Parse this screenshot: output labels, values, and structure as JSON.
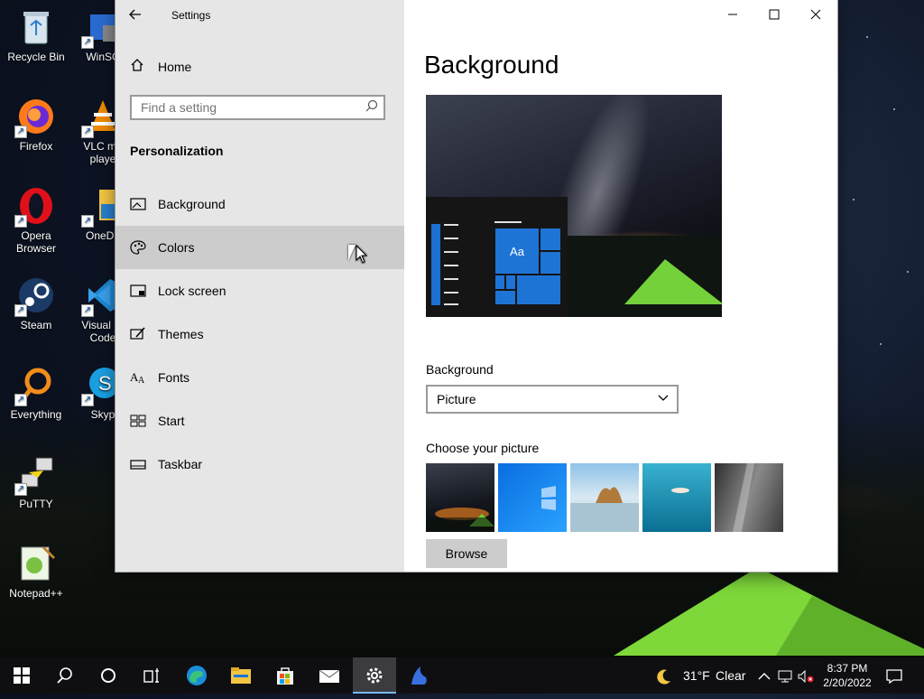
{
  "desktop": {
    "icons": [
      {
        "label": "Recycle Bin",
        "icon": "recycle-bin-icon"
      },
      {
        "label": "WinSC",
        "icon": "winscp-icon"
      },
      {
        "label": "Firefox",
        "icon": "firefox-icon"
      },
      {
        "label": "VLC me",
        "label2": "playe",
        "icon": "vlc-icon"
      },
      {
        "label": "Opera",
        "label2": "Browser",
        "icon": "opera-icon"
      },
      {
        "label": "OneDri",
        "icon": "onedrive-icon"
      },
      {
        "label": "Steam",
        "icon": "steam-icon"
      },
      {
        "label": "Visual St",
        "label2": "Code",
        "icon": "vscode-icon"
      },
      {
        "label": "Everything",
        "icon": "everything-icon"
      },
      {
        "label": "Skyp",
        "icon": "skype-icon"
      },
      {
        "label": "PuTTY",
        "icon": "putty-icon"
      },
      {
        "label": "Notepad++",
        "icon": "notepadpp-icon"
      }
    ]
  },
  "window": {
    "title": "Settings",
    "controls": {
      "minimize": "—",
      "maximize": "☐",
      "close": "✕"
    }
  },
  "sidebar": {
    "home_label": "Home",
    "search_placeholder": "Find a setting",
    "section_title": "Personalization",
    "items": [
      {
        "label": "Background",
        "icon": "picture-icon"
      },
      {
        "label": "Colors",
        "icon": "palette-icon"
      },
      {
        "label": "Lock screen",
        "icon": "lock-screen-icon"
      },
      {
        "label": "Themes",
        "icon": "brush-icon"
      },
      {
        "label": "Fonts",
        "icon": "font-icon"
      },
      {
        "label": "Start",
        "icon": "start-grid-icon"
      },
      {
        "label": "Taskbar",
        "icon": "taskbar-icon"
      }
    ],
    "active_index": 1
  },
  "content": {
    "title": "Background",
    "preview_tile_text": "Aa",
    "background_label": "Background",
    "background_value": "Picture",
    "choose_label": "Choose your picture",
    "thumbnails": [
      "night-tent",
      "windows-blue",
      "beach-rocks",
      "underwater-swimmer",
      "rock-cliff"
    ],
    "browse_label": "Browse"
  },
  "taskbar": {
    "pinned": [
      "start-icon",
      "search-icon",
      "cortana-icon",
      "task-view-icon",
      "edge-icon",
      "file-explorer-icon",
      "store-icon",
      "mail-icon",
      "settings-icon",
      "app-icon"
    ],
    "active": "settings-icon",
    "weather_temp": "31°F",
    "weather_text": "Clear",
    "time": "8:37 PM",
    "date": "2/20/2022"
  },
  "colors": {
    "accent": "#1e74d4",
    "sidebar_bg": "#e6e6e6",
    "active_item_bg": "#cccccc",
    "taskbar_bg": "#0f0f12"
  }
}
